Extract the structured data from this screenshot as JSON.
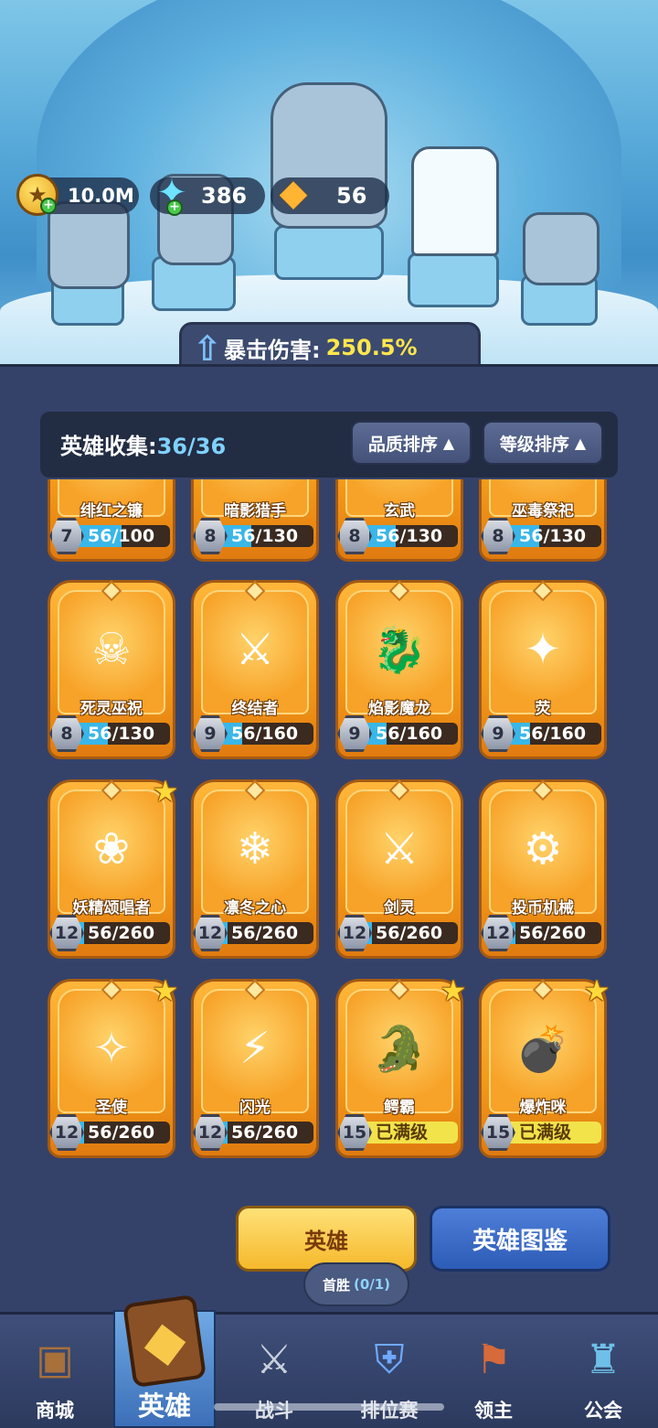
{
  "currency": {
    "gold": "10.0M",
    "gems": "386",
    "shards": "56"
  },
  "crit": {
    "label": "暴击伤害:",
    "value": "250.5%"
  },
  "collection": {
    "label": "英雄收集:",
    "count": "36/36"
  },
  "sort": {
    "quality": "品质排序",
    "level": "等级排序",
    "arrow": "▲"
  },
  "heroes": [
    {
      "name": "绯红之镰",
      "level": "7",
      "progress": "56/100",
      "fill": 0.56,
      "maxed": false,
      "star": false,
      "icon": "scythe-hero"
    },
    {
      "name": "暗影猎手",
      "level": "8",
      "progress": "56/130",
      "fill": 0.43,
      "maxed": false,
      "star": false,
      "icon": "shadow-hunter"
    },
    {
      "name": "玄武",
      "level": "8",
      "progress": "56/130",
      "fill": 0.43,
      "maxed": false,
      "star": false,
      "icon": "turtle"
    },
    {
      "name": "巫毒祭祀",
      "level": "8",
      "progress": "56/130",
      "fill": 0.43,
      "maxed": false,
      "star": false,
      "icon": "voodoo"
    },
    {
      "name": "死灵巫祝",
      "level": "8",
      "progress": "56/130",
      "fill": 0.43,
      "maxed": false,
      "star": false,
      "icon": "necromancer",
      "glyph": "☠"
    },
    {
      "name": "终结者",
      "level": "9",
      "progress": "56/160",
      "fill": 0.35,
      "maxed": false,
      "star": false,
      "icon": "terminator",
      "glyph": "⚔"
    },
    {
      "name": "焰影魔龙",
      "level": "9",
      "progress": "56/160",
      "fill": 0.35,
      "maxed": false,
      "star": false,
      "icon": "dragon",
      "glyph": "🐉"
    },
    {
      "name": "荧",
      "level": "9",
      "progress": "56/160",
      "fill": 0.35,
      "maxed": false,
      "star": false,
      "icon": "witch",
      "glyph": "✦"
    },
    {
      "name": "妖精颂唱者",
      "level": "12",
      "progress": "56/260",
      "fill": 0.22,
      "maxed": false,
      "star": true,
      "icon": "fairy",
      "glyph": "❀"
    },
    {
      "name": "凛冬之心",
      "level": "12",
      "progress": "56/260",
      "fill": 0.22,
      "maxed": false,
      "star": false,
      "icon": "ice-queen",
      "glyph": "❄"
    },
    {
      "name": "剑灵",
      "level": "12",
      "progress": "56/260",
      "fill": 0.22,
      "maxed": false,
      "star": false,
      "icon": "sword-spirit",
      "glyph": "⚔"
    },
    {
      "name": "投币机械",
      "level": "12",
      "progress": "56/260",
      "fill": 0.22,
      "maxed": false,
      "star": false,
      "icon": "slot-machine",
      "glyph": "⚙"
    },
    {
      "name": "圣使",
      "level": "12",
      "progress": "56/260",
      "fill": 0.22,
      "maxed": false,
      "star": true,
      "icon": "angel",
      "glyph": "✧"
    },
    {
      "name": "闪光",
      "level": "12",
      "progress": "56/260",
      "fill": 0.22,
      "maxed": false,
      "star": false,
      "icon": "lightning-cat",
      "glyph": "⚡"
    },
    {
      "name": "鳄霸",
      "level": "15",
      "progress": "已满级",
      "fill": 1.0,
      "maxed": true,
      "star": true,
      "icon": "crocodile",
      "glyph": "🐊"
    },
    {
      "name": "爆炸咪",
      "level": "15",
      "progress": "已满级",
      "fill": 1.0,
      "maxed": true,
      "star": true,
      "icon": "bomb-cat",
      "glyph": "💣"
    }
  ],
  "actions": {
    "hero": "英雄",
    "codex": "英雄图鉴",
    "tooltip_label": "首胜",
    "tooltip_count": "(0/1)"
  },
  "nav": {
    "shop": "商城",
    "hero": "英雄",
    "battle": "战斗",
    "ranked": "排位赛",
    "lord": "领主",
    "guild": "公会"
  },
  "colors": {
    "accent_yellow": "#ffe64d",
    "progress_blue": "#39b7e8",
    "maxed_yellow": "#f2e34a",
    "card_orange": "#f49b1a",
    "panel_bg": "#34426a"
  }
}
